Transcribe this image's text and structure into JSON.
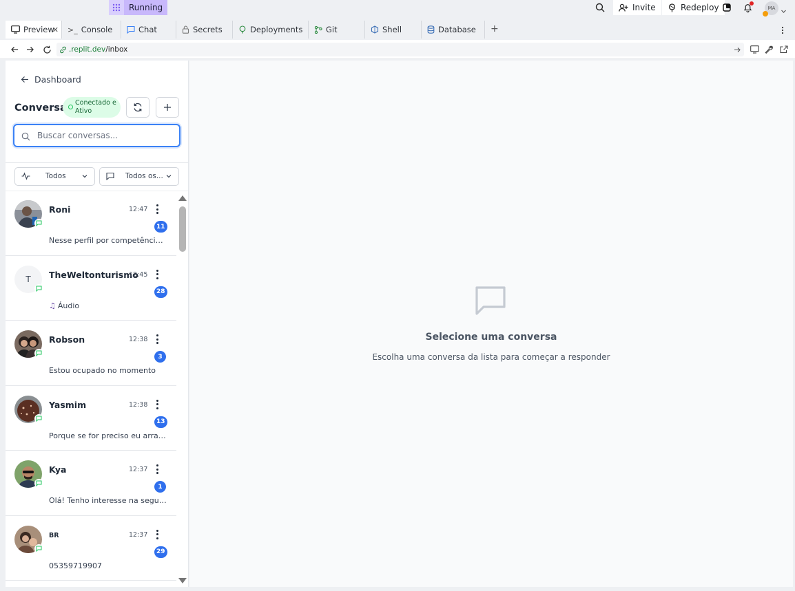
{
  "topbar": {
    "run_status": "Running",
    "invite_label": "Invite",
    "redeploy_label": "Redeploy",
    "user_initials": "MA"
  },
  "tabs": [
    {
      "label": "Preview",
      "icon": "monitor-icon",
      "active": true
    },
    {
      "label": "Console",
      "icon": "terminal-icon"
    },
    {
      "label": "Chat",
      "icon": "chat-icon"
    },
    {
      "label": "Secrets",
      "icon": "lock-icon"
    },
    {
      "label": "Deployments",
      "icon": "deploy-icon"
    },
    {
      "label": "Git",
      "icon": "git-icon"
    },
    {
      "label": "Shell",
      "icon": "shell-icon"
    },
    {
      "label": "Database",
      "icon": "database-icon"
    }
  ],
  "urlbar": {
    "host": ".replit.dev",
    "path": "/inbox"
  },
  "sidebar": {
    "back_label": "Dashboard",
    "title": "Conversas",
    "status_badge": "Conectado e Ativo",
    "search_placeholder": "Buscar conversas...",
    "filter_status": "Todos",
    "filter_channel": "Todos os..."
  },
  "conversations": [
    {
      "name": "Roni",
      "time": "12:47",
      "count": "11",
      "preview": "Nesse perfil por competência si...",
      "avatar": "photo"
    },
    {
      "name": "TheWeltonturismo",
      "initial": "T",
      "time": "12:45",
      "count": "28",
      "preview": "Áudio",
      "audio": true,
      "avatar": "letter"
    },
    {
      "name": "Robson",
      "time": "12:38",
      "count": "3",
      "preview": "Estou ocupado no momento",
      "avatar": "photo"
    },
    {
      "name": "Yasmim",
      "time": "12:38",
      "count": "13",
      "preview": "Porque se for preciso eu arranj...",
      "avatar": "photo"
    },
    {
      "name": "Kya",
      "time": "12:37",
      "count": "1",
      "preview": "Olá! Tenho interesse na segund...",
      "avatar": "photo"
    },
    {
      "name": "BR",
      "time": "12:37",
      "count": "29",
      "preview": "05359719907",
      "avatar": "photo"
    }
  ],
  "main": {
    "empty_title": "Selecione uma conversa",
    "empty_subtitle": "Escolha uma conversa da lista para começar a responder"
  },
  "colors": {
    "accent_blue": "#2f6fed",
    "running_purple": "#c8b8fb",
    "status_green_bg": "#dcfce7"
  }
}
